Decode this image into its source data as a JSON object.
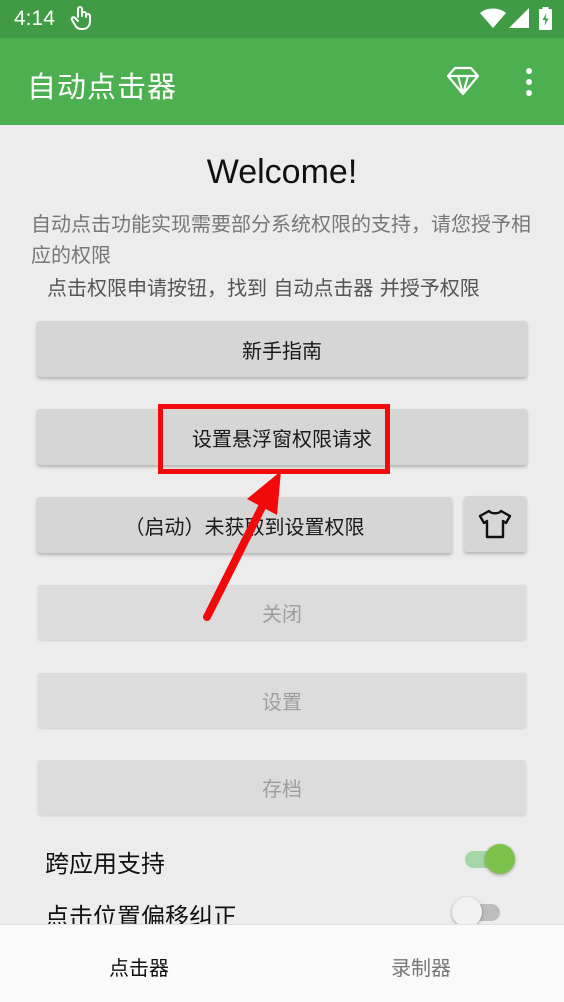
{
  "status_bar": {
    "time": "4:14",
    "icons": [
      "touch-icon",
      "wifi-icon",
      "signal-icon",
      "battery-icon"
    ]
  },
  "app_bar": {
    "title": "自动点击器",
    "actions": [
      "gem-icon",
      "more-vert-icon"
    ]
  },
  "content": {
    "welcome": "Welcome!",
    "desc_line1": "自动点击功能实现需要部分系统权限的支持，请您授予相应的权限",
    "desc_line2": "点击权限申请按钮，找到 自动点击器 并授予权限",
    "buttons": {
      "guide": "新手指南",
      "overlay_permission": "设置悬浮窗权限请求",
      "start": "（启动）未获取到设置权限",
      "close": "关闭",
      "settings": "设置",
      "archive": "存档"
    },
    "shirt_button_icon": "shirt-icon",
    "toggles": [
      {
        "label": "跨应用支持",
        "state": "on"
      },
      {
        "label": "点击位置偏移纠正",
        "state": "off"
      }
    ]
  },
  "bottom_nav": {
    "items": [
      {
        "label": "点击器",
        "selected": true
      },
      {
        "label": "录制器",
        "selected": false
      }
    ]
  },
  "colors": {
    "status_bar": "#3f9c44",
    "app_bar": "#4caf50",
    "highlight": "#f20a0a",
    "toggle_on": "#7dc24a"
  }
}
